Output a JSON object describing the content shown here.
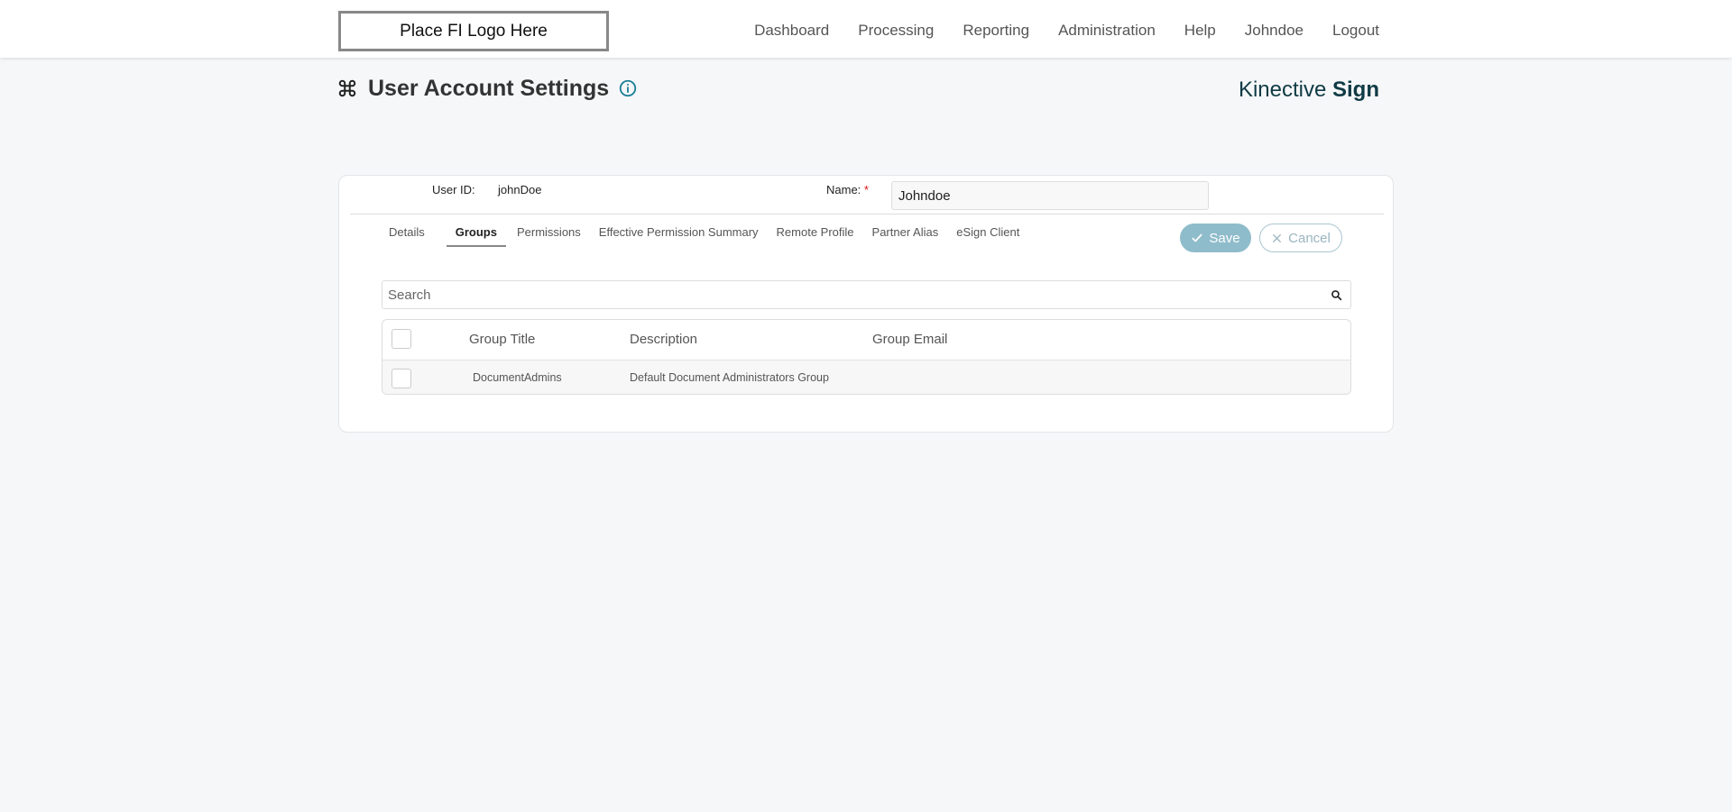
{
  "header": {
    "logo_text": "Place FI Logo Here",
    "nav": [
      "Dashboard",
      "Processing",
      "Reporting",
      "Administration",
      "Help",
      "Johndoe",
      "Logout"
    ]
  },
  "page": {
    "title": "User Account Settings",
    "brand_light": "Kinective",
    "brand_bold": "Sign"
  },
  "form": {
    "user_id_label": "User ID:",
    "user_id_value": "johnDoe",
    "name_label": "Name:",
    "required_mark": "*",
    "name_value": "Johndoe"
  },
  "tabs": [
    {
      "label": "Details",
      "active": false
    },
    {
      "label": "Groups",
      "active": true
    },
    {
      "label": "Permissions",
      "active": false
    },
    {
      "label": "Effective Permission Summary",
      "active": false
    },
    {
      "label": "Remote Profile",
      "active": false
    },
    {
      "label": "Partner Alias",
      "active": false
    },
    {
      "label": "eSign Client",
      "active": false
    }
  ],
  "actions": {
    "save_label": "Save",
    "cancel_label": "Cancel"
  },
  "search": {
    "placeholder": "Search",
    "value": ""
  },
  "table": {
    "columns": [
      "Group Title",
      "Description",
      "Group Email"
    ],
    "rows": [
      {
        "title": "DocumentAdmins",
        "description": "Default Document Administrators Group",
        "email": ""
      }
    ]
  },
  "colors": {
    "brand_dark": "#0f3b45",
    "info_icon": "#1b7f96",
    "save_button": "#8fbccb",
    "required": "#dd1111"
  }
}
